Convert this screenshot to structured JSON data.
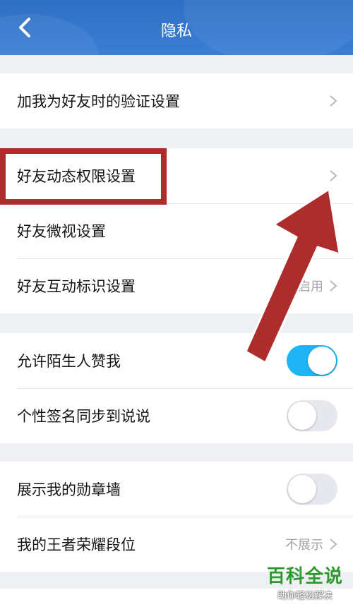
{
  "header": {
    "title": "隐私",
    "back_icon": "chevron-left-icon"
  },
  "group1": [
    {
      "label": "加我为好友时的验证设置",
      "accessory": "chevron"
    }
  ],
  "group2": [
    {
      "label": "好友动态权限设置",
      "accessory": "chevron"
    },
    {
      "label": "好友微视设置",
      "accessory": "none"
    },
    {
      "label": "好友互动标识设置",
      "value": "启用",
      "accessory": "chevron"
    }
  ],
  "group3": [
    {
      "label": "允许陌生人赞我",
      "toggle": true
    },
    {
      "label": "个性签名同步到说说",
      "toggle": false
    }
  ],
  "group4": [
    {
      "label": "展示我的勋章墙",
      "toggle": false
    },
    {
      "label": "我的王者荣耀段位",
      "value": "不展示",
      "accessory": "chevron"
    }
  ],
  "watermark": {
    "main": "百科全说",
    "sub": "助你轻松解决"
  },
  "colors": {
    "header": "#2f6fc4",
    "toggle_on": "#1fb5f5",
    "annotation": "#ad2d2d",
    "watermark": "#2e9a2e"
  }
}
